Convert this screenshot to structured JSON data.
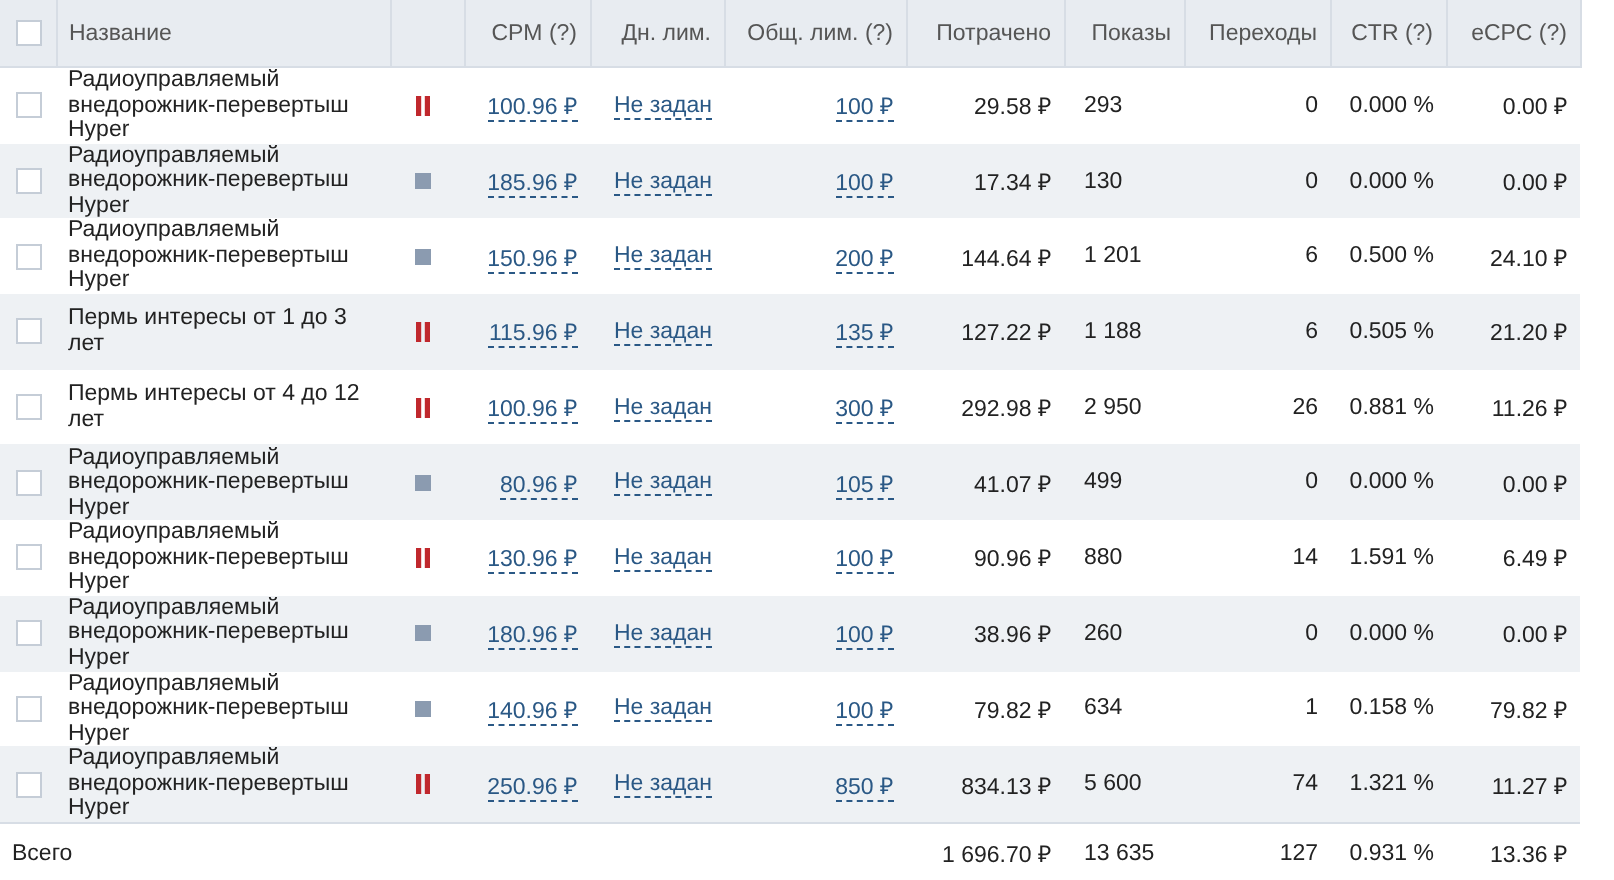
{
  "table": {
    "all_checked": false,
    "columns": [
      "Название",
      "CPM (?)",
      "Дн. лим.",
      "Общ. лим. (?)",
      "Потрачено",
      "Показы",
      "Переходы",
      "CTR (?)",
      "eCPC (?)"
    ],
    "rows": [
      {
        "checked": false,
        "name": "Радиоуправляемый внедорожник-перевертыш Hyper",
        "paused": true,
        "cpm": "100.96 ₽",
        "daily_limit": "Не задан",
        "total_limit": "100 ₽",
        "spent": "29.58 ₽",
        "impressions": "293",
        "clicks": "0",
        "ctr": "0.000 %",
        "ecpc": "0.00 ₽"
      },
      {
        "checked": false,
        "name": "Радиоуправляемый внедорожник-перевертыш Hyper",
        "paused": false,
        "cpm": "185.96 ₽",
        "daily_limit": "Не задан",
        "total_limit": "100 ₽",
        "spent": "17.34 ₽",
        "impressions": "130",
        "clicks": "0",
        "ctr": "0.000 %",
        "ecpc": "0.00 ₽"
      },
      {
        "checked": false,
        "name": "Радиоуправляемый внедорожник-перевертыш Hyper",
        "paused": false,
        "cpm": "150.96 ₽",
        "daily_limit": "Не задан",
        "total_limit": "200 ₽",
        "spent": "144.64 ₽",
        "impressions": "1 201",
        "clicks": "6",
        "ctr": "0.500 %",
        "ecpc": "24.10 ₽"
      },
      {
        "checked": false,
        "name": "Пермь интересы от 1 до 3 лет",
        "paused": true,
        "cpm": "115.96 ₽",
        "daily_limit": "Не задан",
        "total_limit": "135 ₽",
        "spent": "127.22 ₽",
        "impressions": "1 188",
        "clicks": "6",
        "ctr": "0.505 %",
        "ecpc": "21.20 ₽"
      },
      {
        "checked": false,
        "name": "Пермь интересы от 4 до 12 лет",
        "paused": true,
        "cpm": "100.96 ₽",
        "daily_limit": "Не задан",
        "total_limit": "300 ₽",
        "spent": "292.98 ₽",
        "impressions": "2 950",
        "clicks": "26",
        "ctr": "0.881 %",
        "ecpc": "11.26 ₽"
      },
      {
        "checked": false,
        "name": "Радиоуправляемый внедорожник-перевертыш Hyper",
        "paused": false,
        "cpm": "80.96 ₽",
        "daily_limit": "Не задан",
        "total_limit": "105 ₽",
        "spent": "41.07 ₽",
        "impressions": "499",
        "clicks": "0",
        "ctr": "0.000 %",
        "ecpc": "0.00 ₽"
      },
      {
        "checked": false,
        "name": "Радиоуправляемый внедорожник-перевертыш Hyper",
        "paused": true,
        "cpm": "130.96 ₽",
        "daily_limit": "Не задан",
        "total_limit": "100 ₽",
        "spent": "90.96 ₽",
        "impressions": "880",
        "clicks": "14",
        "ctr": "1.591 %",
        "ecpc": "6.49 ₽"
      },
      {
        "checked": false,
        "name": "Радиоуправляемый внедорожник-перевертыш Hyper",
        "paused": false,
        "cpm": "180.96 ₽",
        "daily_limit": "Не задан",
        "total_limit": "100 ₽",
        "spent": "38.96 ₽",
        "impressions": "260",
        "clicks": "0",
        "ctr": "0.000 %",
        "ecpc": "0.00 ₽"
      },
      {
        "checked": false,
        "name": "Радиоуправляемый внедорожник-перевертыш Hyper",
        "paused": false,
        "cpm": "140.96 ₽",
        "daily_limit": "Не задан",
        "total_limit": "100 ₽",
        "spent": "79.82 ₽",
        "impressions": "634",
        "clicks": "1",
        "ctr": "0.158 %",
        "ecpc": "79.82 ₽"
      },
      {
        "checked": false,
        "name": "Радиоуправляемый внедорожник-перевертыш Hyper",
        "paused": true,
        "cpm": "250.96 ₽",
        "daily_limit": "Не задан",
        "total_limit": "850 ₽",
        "spent": "834.13 ₽",
        "impressions": "5 600",
        "clicks": "74",
        "ctr": "1.321 %",
        "ecpc": "11.27 ₽"
      }
    ],
    "total": {
      "label": "Всего",
      "spent": "1 696.70 ₽",
      "impressions": "13 635",
      "clicks": "127",
      "ctr": "0.931 %",
      "ecpc": "13.36 ₽"
    }
  }
}
